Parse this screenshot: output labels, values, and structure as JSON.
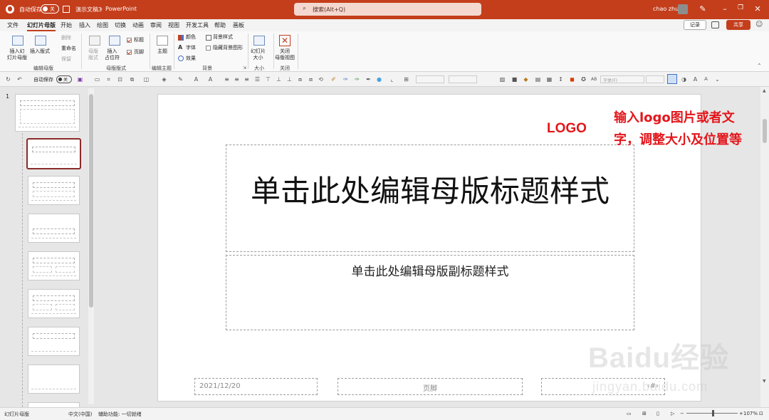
{
  "titlebar": {
    "autosave_label": "自动保存",
    "autosave_state": "关",
    "doc_name": "演示文稿3",
    "separator": "-",
    "app_name": "PowerPoint",
    "search_placeholder": "搜索(Alt+Q)",
    "user_name": "chao zhu",
    "bg_color": "#c43e1c"
  },
  "tabs": [
    "文件",
    "幻灯片母版",
    "开始",
    "插入",
    "绘图",
    "切换",
    "动画",
    "审阅",
    "视图",
    "开发工具",
    "帮助",
    "画板"
  ],
  "active_tab": "幻灯片母版",
  "record_label": "记录",
  "share_label": "共享",
  "ribbon": {
    "insert_master": "插入幻\n灯片母版",
    "insert_layout": "插入版式",
    "delete": "删除",
    "rename": "重命名",
    "preserve": "保留",
    "master_layout": "母版\n版式",
    "insert_placeholder": "插入\n占位符",
    "title_chk": "标题",
    "footer_chk": "页脚",
    "themes": "主题",
    "colors": "颜色",
    "fonts": "字体",
    "effects": "效果",
    "bg_styles": "背景样式",
    "hide_bg": "隐藏背景图形",
    "slide_size": "幻灯片\n大小",
    "close_master": "关闭\n母版视图",
    "groups": {
      "edit_master": "编辑母版",
      "master_layout": "母版版式",
      "edit_theme": "编辑主题",
      "background": "背景",
      "size": "大小",
      "close": "关闭"
    }
  },
  "toolbar": {
    "autosave_label": "自动保存",
    "autosave_state": "关",
    "font_placeholder": "字体(F)"
  },
  "thumbnails": {
    "slide_number": "1",
    "count": 9
  },
  "slide": {
    "title_placeholder": "单击此处编辑母版标题样式",
    "subtitle_placeholder": "单击此处编辑母版副标题样式",
    "date": "2021/12/20",
    "footer": "页脚",
    "slide_number": "‹#›"
  },
  "annotations": {
    "logo": "LOGO",
    "instruction": "输入logo图片或者文字，调整大小及位置等",
    "color": "#e3161b"
  },
  "status": {
    "view": "幻灯片母版",
    "language": "中文(中国)",
    "accessibility": "辅助功能: 一切就绪",
    "zoom": "107%"
  },
  "watermark": {
    "brand": "Baidu经验",
    "url": "jingyan.baidu.com"
  }
}
